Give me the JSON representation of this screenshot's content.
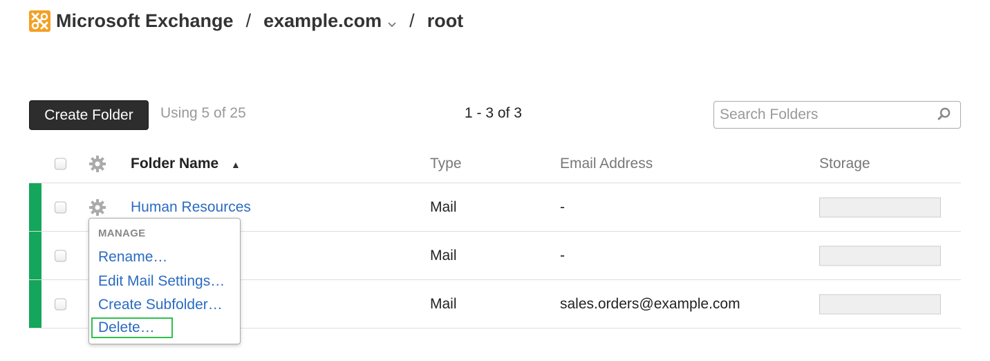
{
  "breadcrumb": {
    "app": "Microsoft Exchange",
    "separator": "/",
    "domain": "example.com",
    "folder": "root",
    "logo_icon": "exchange-logo-icon",
    "logo_color": "#f3a024"
  },
  "toolbar": {
    "create_label": "Create Folder",
    "usage": "Using 5 of 25",
    "paging": "1 - 3 of 3",
    "search_placeholder": "Search Folders",
    "search_icon": "search-icon"
  },
  "table": {
    "columns": {
      "name": "Folder Name",
      "type": "Type",
      "email": "Email Address",
      "storage": "Storage"
    },
    "sort_indicator": "▲",
    "rows": [
      {
        "name": "Human Resources",
        "type": "Mail",
        "email": "-"
      },
      {
        "name": "",
        "type": "Mail",
        "email": "-"
      },
      {
        "name": "",
        "type": "Mail",
        "email": "sales.orders@example.com"
      }
    ],
    "status_color": "#14a65a"
  },
  "menu": {
    "title": "MANAGE",
    "items": [
      "Rename…",
      "Edit Mail Settings…",
      "Create Subfolder…",
      "Delete…"
    ],
    "highlight_color": "#2ec04f"
  }
}
